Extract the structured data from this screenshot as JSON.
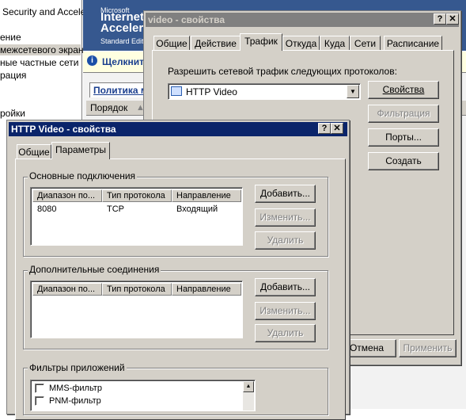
{
  "background_app": {
    "left_tree": [
      "Security and Accele",
      "ение",
      "межсетевого экран",
      "ные частные сети",
      "рация",
      "ройки"
    ],
    "isa_logo_line1": "Microsoft",
    "isa_logo_line2": "Internet",
    "isa_logo_line3": "Accelera",
    "isa_logo_line4": "Standard Editi",
    "info_bar_text": "Щелкните",
    "policy_link": "Политика м",
    "order_column": "Порядок"
  },
  "video_dialog": {
    "title": "video - свойства",
    "tabs": [
      "Общие",
      "Действие",
      "Трафик",
      "Откуда",
      "Куда",
      "Сети",
      "Расписание"
    ],
    "active_tab": "Трафик",
    "protocols_label": "Разрешить сетевой трафик следующих протоколов:",
    "protocol_selected": "HTTP Video",
    "btn_properties": "Свойства",
    "btn_filtering": "Фильтрация",
    "btn_ports": "Порты...",
    "btn_create": "Создать",
    "btn_cancel": "Отмена",
    "btn_apply": "Применить"
  },
  "http_dialog": {
    "title": "HTTP Video - свойства",
    "tabs": [
      "Общие",
      "Параметры"
    ],
    "active_tab": "Параметры",
    "primary_group": "Основные подключения",
    "secondary_group": "Дополнительные соединения",
    "filters_group": "Фильтры приложений",
    "columns": [
      "Диапазон по...",
      "Тип протокола",
      "Направление"
    ],
    "primary_rows": [
      {
        "range": "8080",
        "protocol": "TCP",
        "direction": "Входящий"
      }
    ],
    "btn_add": "Добавить...",
    "btn_edit": "Изменить...",
    "btn_delete": "Удалить",
    "filters": [
      {
        "label": "MMS-фильтр",
        "checked": false
      },
      {
        "label": "PNM-фильтр",
        "checked": false
      }
    ]
  }
}
